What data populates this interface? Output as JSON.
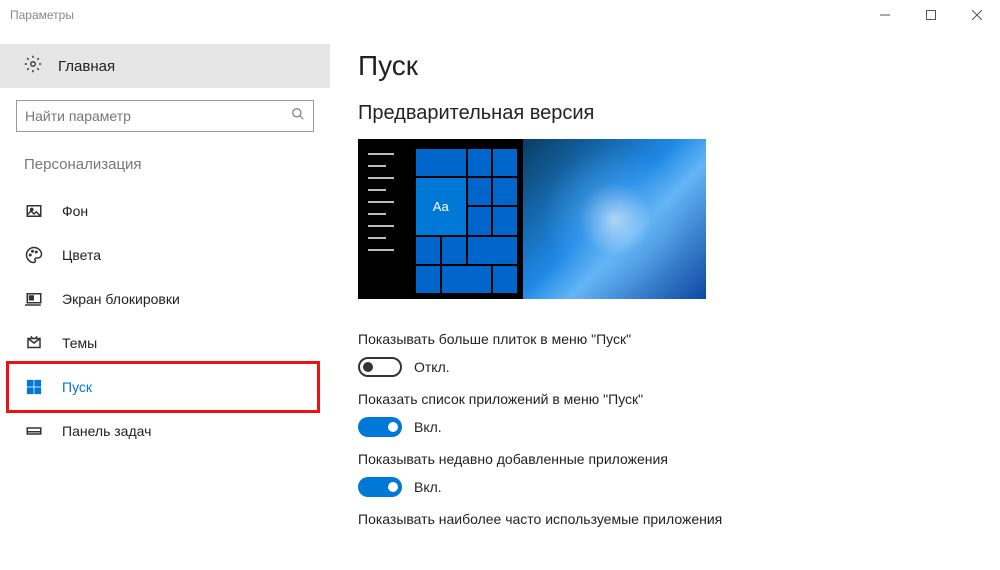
{
  "window": {
    "title": "Параметры"
  },
  "sidebar": {
    "home": "Главная",
    "search_placeholder": "Найти параметр",
    "section": "Персонализация",
    "items": [
      {
        "label": "Фон"
      },
      {
        "label": "Цвета"
      },
      {
        "label": "Экран блокировки"
      },
      {
        "label": "Темы"
      },
      {
        "label": "Пуск"
      },
      {
        "label": "Панель задач"
      }
    ]
  },
  "main": {
    "heading": "Пуск",
    "preview_heading": "Предварительная версия",
    "preview_tile_text": "Aa",
    "settings": [
      {
        "label": "Показывать больше плиток в меню \"Пуск\"",
        "on": false,
        "state": "Откл."
      },
      {
        "label": "Показать список приложений в меню \"Пуск\"",
        "on": true,
        "state": "Вкл."
      },
      {
        "label": "Показывать недавно добавленные приложения",
        "on": true,
        "state": "Вкл."
      },
      {
        "label": "Показывать наиболее часто используемые приложения",
        "on": null,
        "state": ""
      }
    ]
  }
}
